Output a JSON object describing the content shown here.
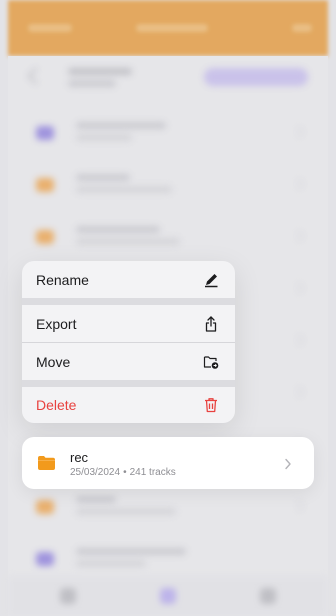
{
  "colors": {
    "accent_orange": "#e89a38",
    "folder_orange": "#f29a1c",
    "delete_red": "#e8423f",
    "background": "#e9e9ec"
  },
  "menu": {
    "items": [
      {
        "label": "Rename",
        "icon": "pencil-icon"
      },
      {
        "label": "Export",
        "icon": "share-icon"
      },
      {
        "label": "Move",
        "icon": "folder-move-icon"
      },
      {
        "label": "Delete",
        "icon": "trash-icon"
      }
    ]
  },
  "folder_card": {
    "name": "rec",
    "date": "25/03/2024",
    "separator": "•",
    "tracks": "241 tracks",
    "icon": "folder-icon"
  }
}
